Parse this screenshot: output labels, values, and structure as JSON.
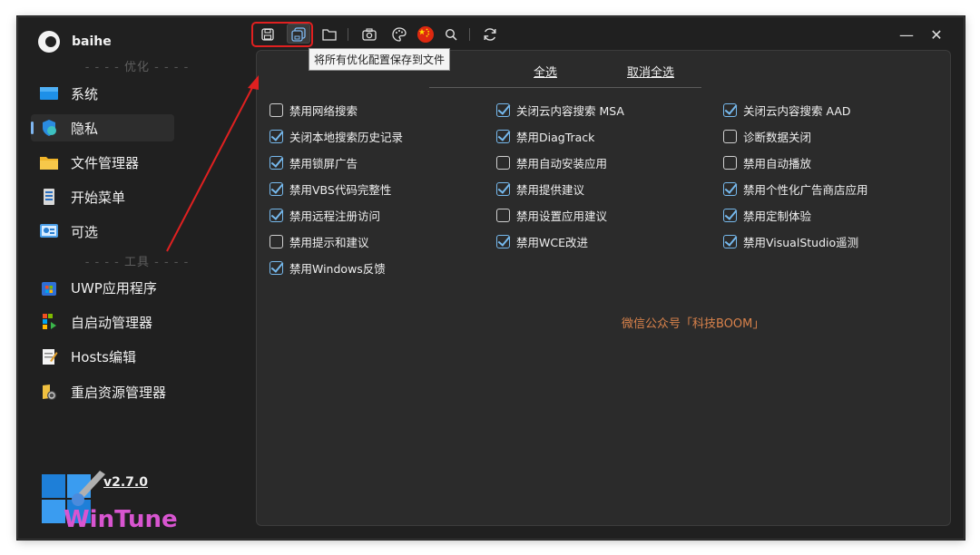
{
  "user": {
    "name": "baihe"
  },
  "sidebar": {
    "section_optimize": "优化",
    "section_tools": "工具",
    "items": [
      {
        "label": "系统",
        "icon": "monitor-icon"
      },
      {
        "label": "隐私",
        "icon": "shield-icon",
        "active": true
      },
      {
        "label": "文件管理器",
        "icon": "folder-icon"
      },
      {
        "label": "开始菜单",
        "icon": "start-menu-icon"
      },
      {
        "label": "可选",
        "icon": "control-panel-icon"
      }
    ],
    "tools": [
      {
        "label": "UWP应用程序",
        "icon": "store-icon"
      },
      {
        "label": "自启动管理器",
        "icon": "startup-icon"
      },
      {
        "label": "Hosts编辑",
        "icon": "notepad-icon"
      },
      {
        "label": "重启资源管理器",
        "icon": "explorer-restart-icon"
      }
    ],
    "version": "v2.7.0",
    "logo_text": "WinTune"
  },
  "toolbar": {
    "tooltip": "将所有优化配置保存到文件",
    "icons": [
      "save-icon",
      "save-all-icon",
      "open-folder-icon",
      "camera-icon",
      "palette-icon",
      "china-flag-icon",
      "search-icon",
      "refresh-icon"
    ]
  },
  "window_controls": {
    "minimize": "—",
    "close": "✕"
  },
  "main": {
    "select_all": "全选",
    "deselect_all": "取消全选",
    "options": [
      {
        "label": "禁用网络搜索",
        "checked": false
      },
      {
        "label": "关闭云内容搜索 MSA",
        "checked": true
      },
      {
        "label": "关闭云内容搜索 AAD",
        "checked": true
      },
      {
        "label": "关闭本地搜索历史记录",
        "checked": true
      },
      {
        "label": "禁用DiagTrack",
        "checked": true
      },
      {
        "label": "诊断数据关闭",
        "checked": false
      },
      {
        "label": "禁用锁屏广告",
        "checked": true
      },
      {
        "label": "禁用自动安装应用",
        "checked": false
      },
      {
        "label": "禁用自动播放",
        "checked": false
      },
      {
        "label": "禁用VBS代码完整性",
        "checked": true
      },
      {
        "label": "禁用提供建议",
        "checked": true
      },
      {
        "label": "禁用个性化广告商店应用",
        "checked": true
      },
      {
        "label": "禁用远程注册访问",
        "checked": true
      },
      {
        "label": "禁用设置应用建议",
        "checked": false
      },
      {
        "label": "禁用定制体验",
        "checked": true
      },
      {
        "label": "禁用提示和建议",
        "checked": false
      },
      {
        "label": "禁用WCE改进",
        "checked": true
      },
      {
        "label": "禁用VisualStudio遥测",
        "checked": true
      },
      {
        "label": "禁用Windows反馈",
        "checked": true
      }
    ]
  },
  "watermark": "微信公众号「科技BOOM」",
  "colors": {
    "accent": "#76b9ed",
    "annotation": "#e02020",
    "watermark": "#d9824b"
  }
}
